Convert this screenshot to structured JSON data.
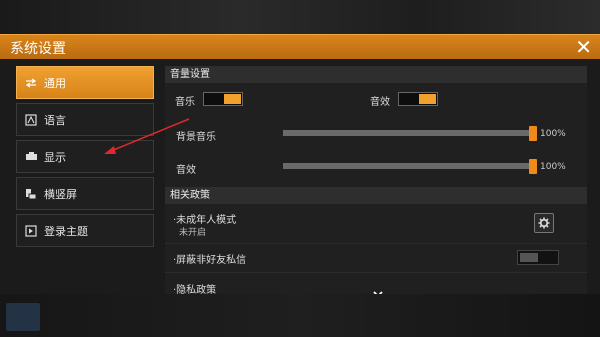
{
  "window": {
    "title": "系统设置"
  },
  "sidebar": {
    "items": [
      {
        "label": "通用",
        "icon": "sliders-icon",
        "active": true
      },
      {
        "label": "语言",
        "icon": "language-icon",
        "active": false
      },
      {
        "label": "显示",
        "icon": "display-icon",
        "active": false
      },
      {
        "label": "横竖屏",
        "icon": "orientation-icon",
        "active": false
      },
      {
        "label": "登录主题",
        "icon": "theme-icon",
        "active": false
      }
    ]
  },
  "volume": {
    "header": "音量设置",
    "music_label": "音乐",
    "sfx_label": "音效",
    "music_on": true,
    "sfx_on": true,
    "bgm_label": "背景音乐",
    "bgm_value": "100%",
    "bgm_level": 1.0,
    "effect_label": "音效",
    "effect_value": "100%",
    "effect_level": 1.0
  },
  "policy": {
    "header": "相关政策",
    "minor_mode_label": "·未成年人模式",
    "minor_mode_status": "未开启",
    "block_pm_label": "·屏蔽非好友私信",
    "block_pm_on": false,
    "privacy_label": "·隐私政策"
  },
  "colors": {
    "accent": "#f0a22c",
    "titlebar": "#c9771a"
  }
}
